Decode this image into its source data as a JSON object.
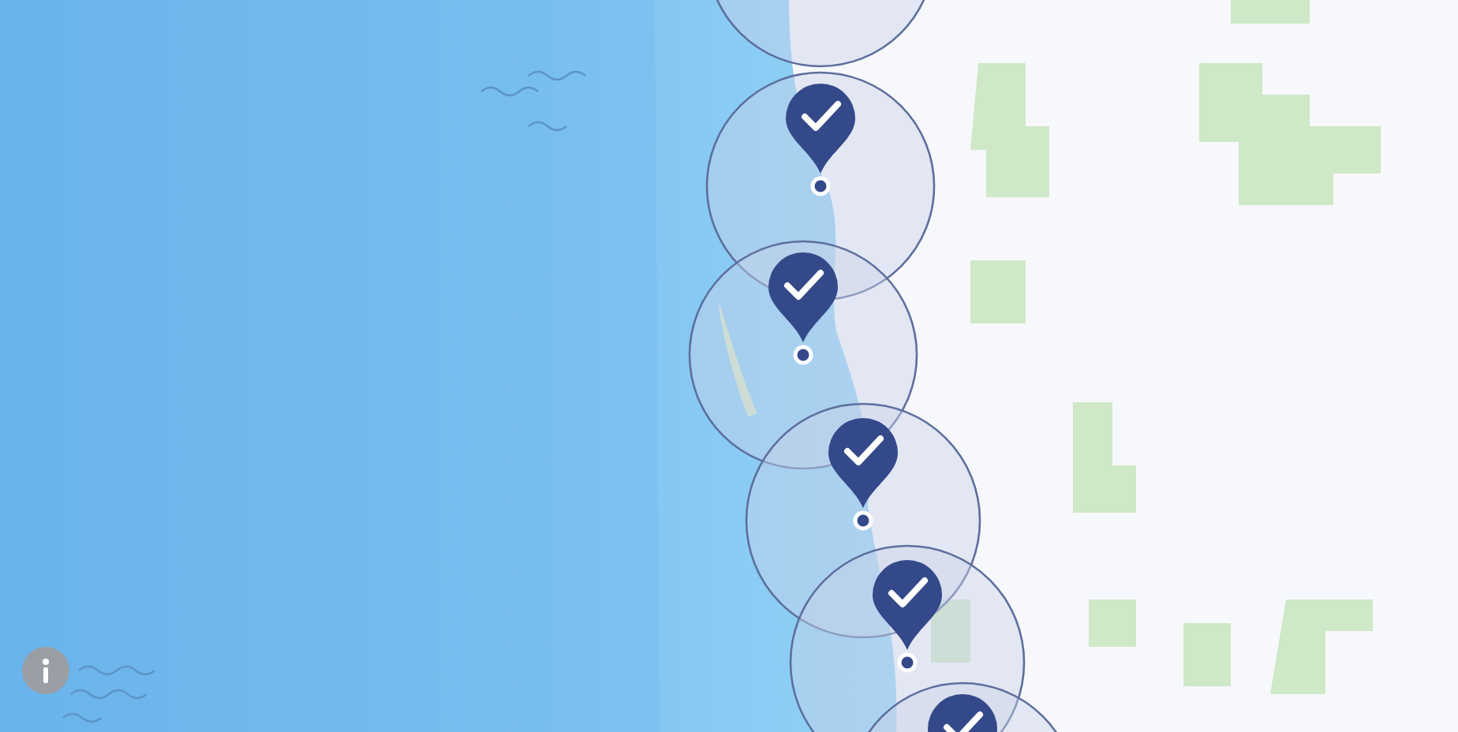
{
  "map": {
    "markers": [
      {
        "checked": true
      },
      {
        "checked": true
      },
      {
        "checked": true
      },
      {
        "checked": true
      },
      {
        "checked": true
      }
    ]
  }
}
